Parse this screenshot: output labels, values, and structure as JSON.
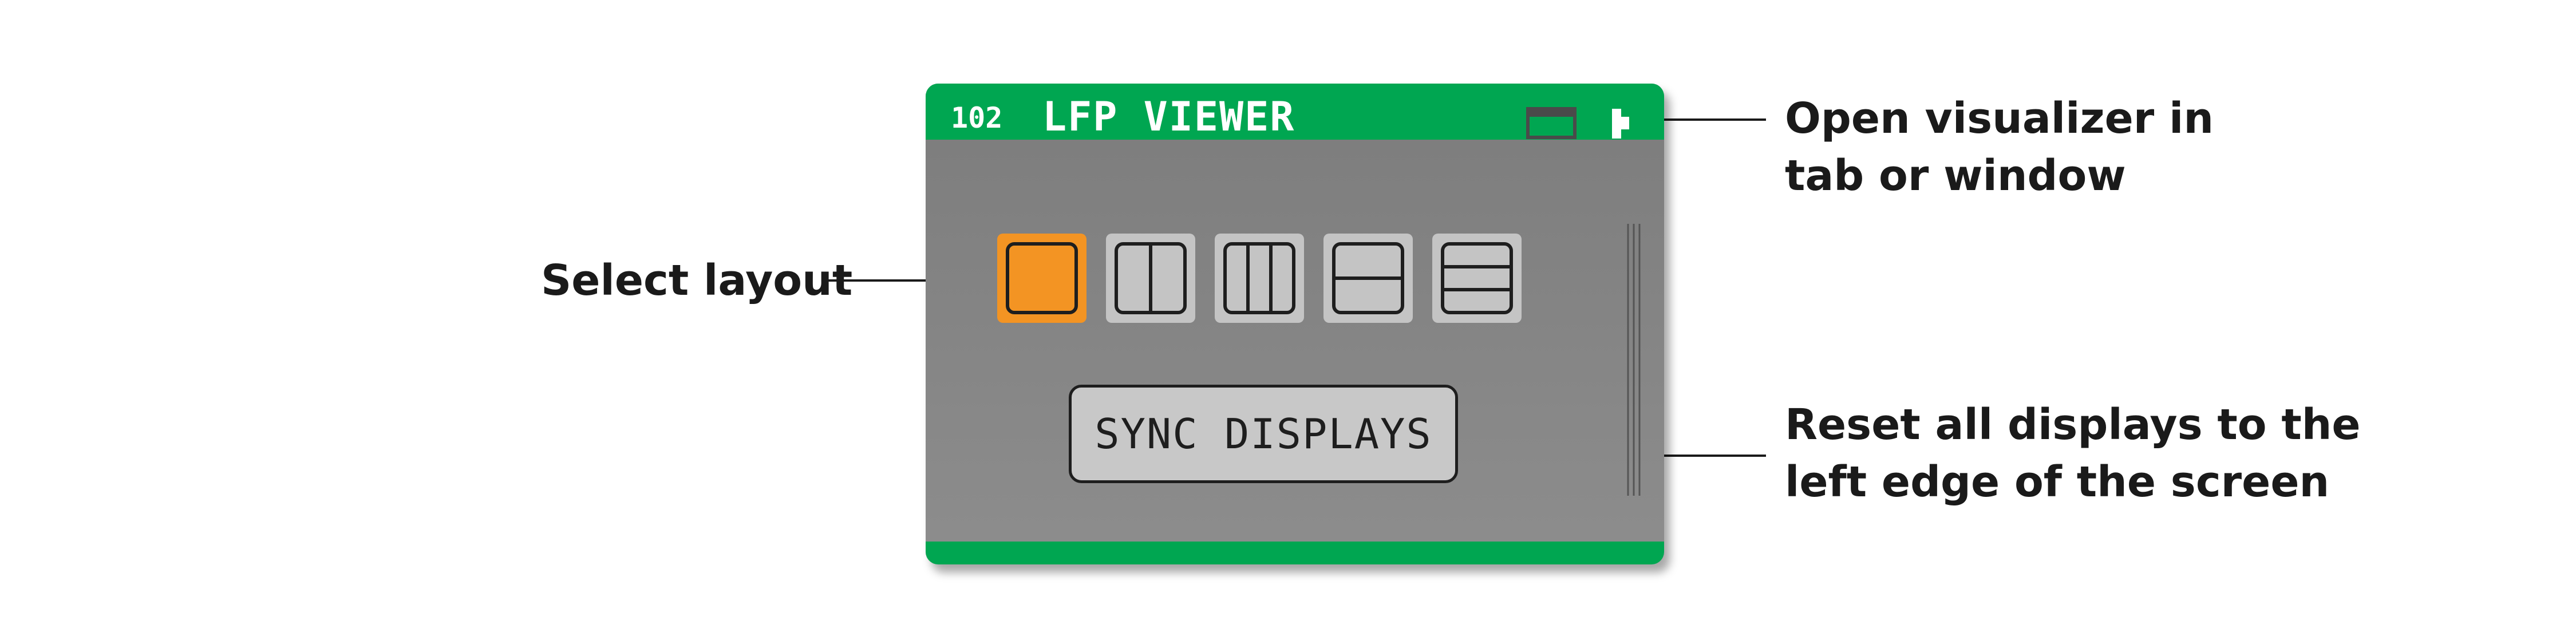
{
  "panel": {
    "node_id": "102",
    "plugin_name": "LFP VIEWER",
    "header_color": "#00a651",
    "footer_color": "#00a651",
    "body_color": "#858585",
    "window_button_icon": "window-icon",
    "tab_button_icon": "tab-icon",
    "layouts": [
      {
        "name": "single",
        "selected": true
      },
      {
        "name": "two-columns",
        "selected": false
      },
      {
        "name": "three-columns",
        "selected": false
      },
      {
        "name": "two-rows",
        "selected": false
      },
      {
        "name": "three-rows",
        "selected": false
      }
    ],
    "selected_color": "#f39423",
    "sync_button_label": "SYNC DISPLAYS"
  },
  "annotations": {
    "select_layout": "Select layout",
    "open_visualizer_line1": "Open visualizer in",
    "open_visualizer_line2": "tab or window",
    "reset_displays_line1": "Reset all displays to the",
    "reset_displays_line2": "left edge of the screen"
  }
}
